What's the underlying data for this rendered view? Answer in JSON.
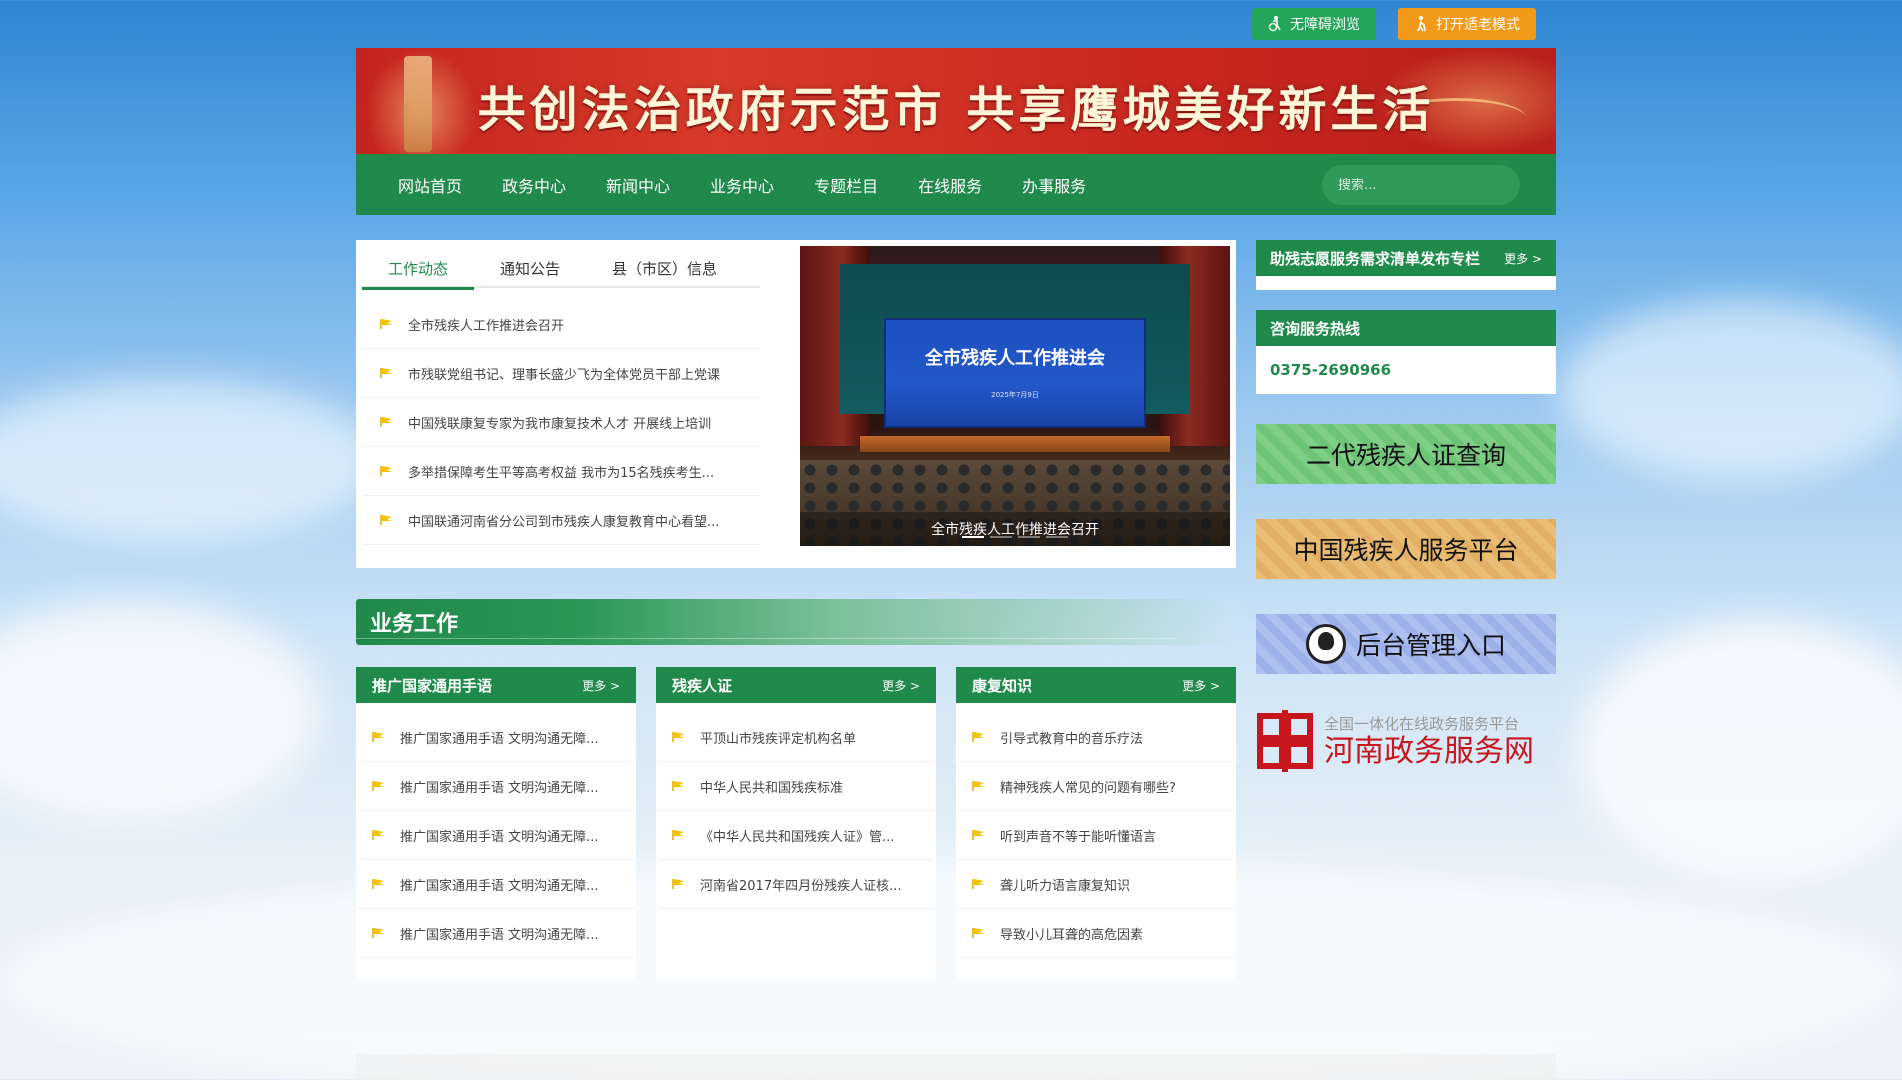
{
  "access_bar": {
    "accessible_label": "无障碍浏览",
    "elder_label": "打开适老模式"
  },
  "banner": {
    "slogan": "共创法治政府示范市  共享鹰城美好新生活"
  },
  "nav": {
    "items": [
      "网站首页",
      "政务中心",
      "新闻中心",
      "业务中心",
      "专题栏目",
      "在线服务",
      "办事服务"
    ],
    "search_placeholder": "搜索..."
  },
  "news": {
    "tabs": [
      "工作动态",
      "通知公告",
      "县（市区）信息"
    ],
    "active_tab": 0,
    "items": [
      "全市残疾人工作推进会召开",
      "市残联党组书记、理事长盛少飞为全体党员干部上党课",
      "中国残联康复专家为我市康复技术人才 开展线上培训",
      "多举措保障考生平等高考权益 我市为15名残疾考生...",
      "中国联通河南省分公司到市残疾人康复教育中心看望..."
    ],
    "feature": {
      "screen_title": "全市残疾人工作推进会",
      "screen_date": "2025年7月9日",
      "caption": "全市残疾人工作推进会召开"
    }
  },
  "business": {
    "title": "业务工作",
    "columns": [
      {
        "title": "推广国家通用手语",
        "more": "更多 >",
        "items": [
          "推广国家通用手语 文明沟通无障...",
          "推广国家通用手语 文明沟通无障...",
          "推广国家通用手语 文明沟通无障...",
          "推广国家通用手语 文明沟通无障...",
          "推广国家通用手语 文明沟通无障..."
        ]
      },
      {
        "title": "残疾人证",
        "more": "更多 >",
        "items": [
          "平顶山市残疾评定机构名单",
          "中华人民共和国残疾标准",
          "《中华人民共和国残疾人证》管...",
          "河南省2017年四月份残疾人证核..."
        ]
      },
      {
        "title": "康复知识",
        "more": "更多 >",
        "items": [
          "引导式教育中的音乐疗法",
          "精神残疾人常见的问题有哪些?",
          "听到声音不等于能听懂语言",
          "聋儿听力语言康复知识",
          "导致小儿耳聋的高危因素"
        ]
      }
    ]
  },
  "sidebar": {
    "volunteer": {
      "title": "助残志愿服务需求清单发布专栏",
      "more": "更多 >"
    },
    "hotline": {
      "title": "咨询服务热线",
      "number": "0375-2690966"
    },
    "promo_1": "二代残疾人证查询",
    "promo_2": "中国残疾人服务平台",
    "promo_3": "后台管理入口",
    "henan": {
      "sub": "全国一体化在线政务服务平台",
      "main": "河南政务服务网"
    }
  },
  "colors": {
    "primary_green": "#1f8a4c",
    "banner_red": "#c8261f",
    "elder_orange": "#f39a1a",
    "access_green": "#23a55a",
    "henan_red": "#c8161d"
  }
}
